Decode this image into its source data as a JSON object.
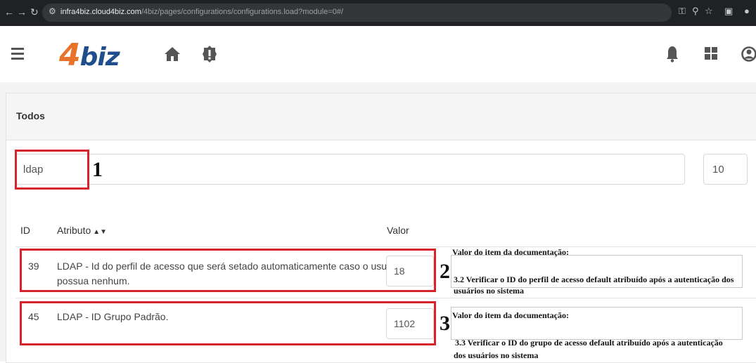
{
  "browser": {
    "url_host": "infra4biz.cloud4biz.com",
    "url_path": "/4biz/pages/configurations/configurations.load?module=0#/"
  },
  "header": {
    "logo_number": "4",
    "logo_text": "biz"
  },
  "panel": {
    "title": "Todos"
  },
  "search": {
    "value": "ldap",
    "page_size": "10"
  },
  "table": {
    "headers": {
      "id": "ID",
      "attribute": "Atributo",
      "value": "Valor"
    },
    "rows": [
      {
        "id": "39",
        "attribute_line1": "LDAP - Id do perfil de acesso que será setado automaticamente caso o usuário não",
        "attribute_line2": "possua nenhum.",
        "value": "18"
      },
      {
        "id": "45",
        "attribute_line1": "LDAP - ID Grupo Padrão.",
        "value": "1102"
      }
    ]
  },
  "annotations": {
    "markers": [
      "1",
      "2",
      "3"
    ],
    "notes": [
      {
        "title": "Valor do item da documentação:",
        "line1": "3.2 Verificar o ID do perfil de acesso default atribuído após a autenticação dos",
        "line2": "usuários no sistema"
      },
      {
        "title": "Valor do item da documentação:",
        "line1": "3.3 Verificar o ID do grupo de acesso default atribuído após a autenticação",
        "line2": "dos usuários no sistema"
      }
    ],
    "highlight_color": "#d7232c"
  },
  "colors": {
    "logo_orange": "#e8732a",
    "logo_blue": "#1f4e8c"
  }
}
